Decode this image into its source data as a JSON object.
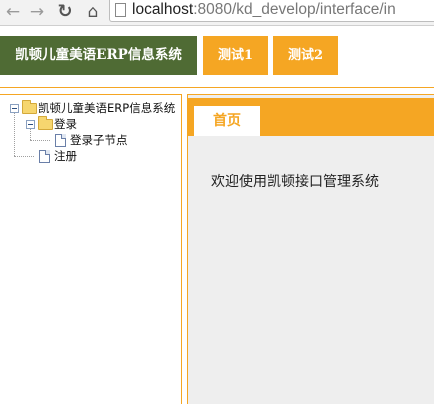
{
  "browser": {
    "back_icon": "←",
    "forward_icon": "→",
    "reload_icon": "↻",
    "home_icon": "⌂",
    "url_host": "localhost",
    "url_rest": ":8080/kd_develop/interface/in"
  },
  "header": {
    "brand_title": "凯顿儿童美语ERP信息系统",
    "tabs": [
      {
        "label": "测试1"
      },
      {
        "label": "测试2"
      }
    ]
  },
  "tree": {
    "root": {
      "label": "凯顿儿童美语ERP信息系统"
    },
    "children": [
      {
        "label": "登录",
        "children": [
          {
            "label": "登录子节点"
          }
        ]
      },
      {
        "label": "注册"
      }
    ]
  },
  "content": {
    "active_tab": "首页",
    "welcome_text": "欢迎使用凯顿接口管理系统"
  },
  "colors": {
    "brand_green": "#4f6b34",
    "accent_orange": "#f5a623",
    "content_gray": "#eeeeee"
  }
}
